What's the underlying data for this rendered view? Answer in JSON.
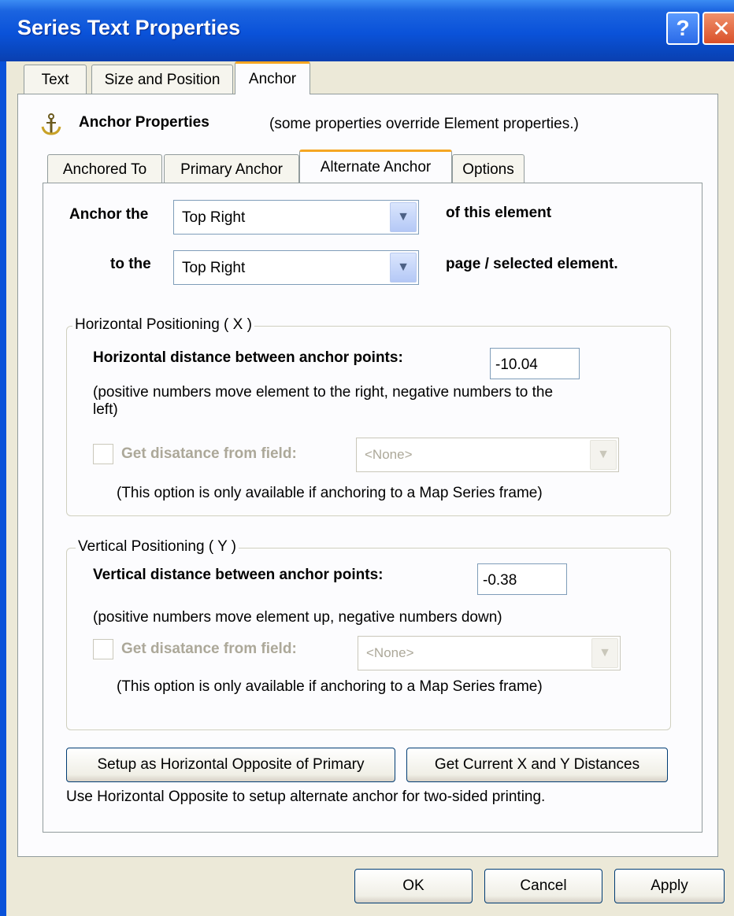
{
  "window": {
    "title": "Series Text Properties",
    "help_glyph": "?",
    "close_glyph": "✕"
  },
  "tabs": [
    "Text",
    "Size and Position",
    "Anchor"
  ],
  "anchor_header": {
    "icon": "anchor-icon",
    "title": "Anchor Properties",
    "note": "(some properties override Element properties.)"
  },
  "subtabs": [
    "Anchored To",
    "Primary Anchor",
    "Alternate Anchor",
    "Options"
  ],
  "anchor_row": {
    "label": "Anchor the",
    "value": "Top Right",
    "suffix": "of this element"
  },
  "to_row": {
    "label": "to the",
    "value": "Top Right",
    "suffix": "page / selected element."
  },
  "horizontal": {
    "legend": "Horizontal Positioning ( X )",
    "distance_label": "Horizontal distance between anchor points:",
    "distance_value": "-10.04",
    "hint_line1": "(positive numbers move element to the right, negative numbers to the",
    "hint_line2": "left)",
    "field_label": "Get disatance from field:",
    "field_value": "<None>",
    "note": "(This option is only available if anchoring to a Map Series frame)"
  },
  "vertical": {
    "legend": "Vertical Positioning ( Y )",
    "distance_label": "Vertical distance between anchor points:",
    "distance_value": "-0.38",
    "hint": "(positive numbers move element up, negative numbers down)",
    "field_label": "Get disatance from field:",
    "field_value": "<None>",
    "note": "(This option is only available if anchoring to a Map Series frame)"
  },
  "actions": {
    "opposite_button": "Setup as Horizontal Opposite of Primary",
    "current_button": "Get Current X and Y Distances",
    "help_text": "Use Horizontal Opposite to setup alternate anchor for two-sided printing."
  },
  "footer": {
    "ok": "OK",
    "cancel": "Cancel",
    "apply": "Apply"
  },
  "colors": {
    "titlebar": "#0a52d9",
    "tab_highlight": "#f5a623",
    "dialog_bg": "#ece9d8"
  }
}
